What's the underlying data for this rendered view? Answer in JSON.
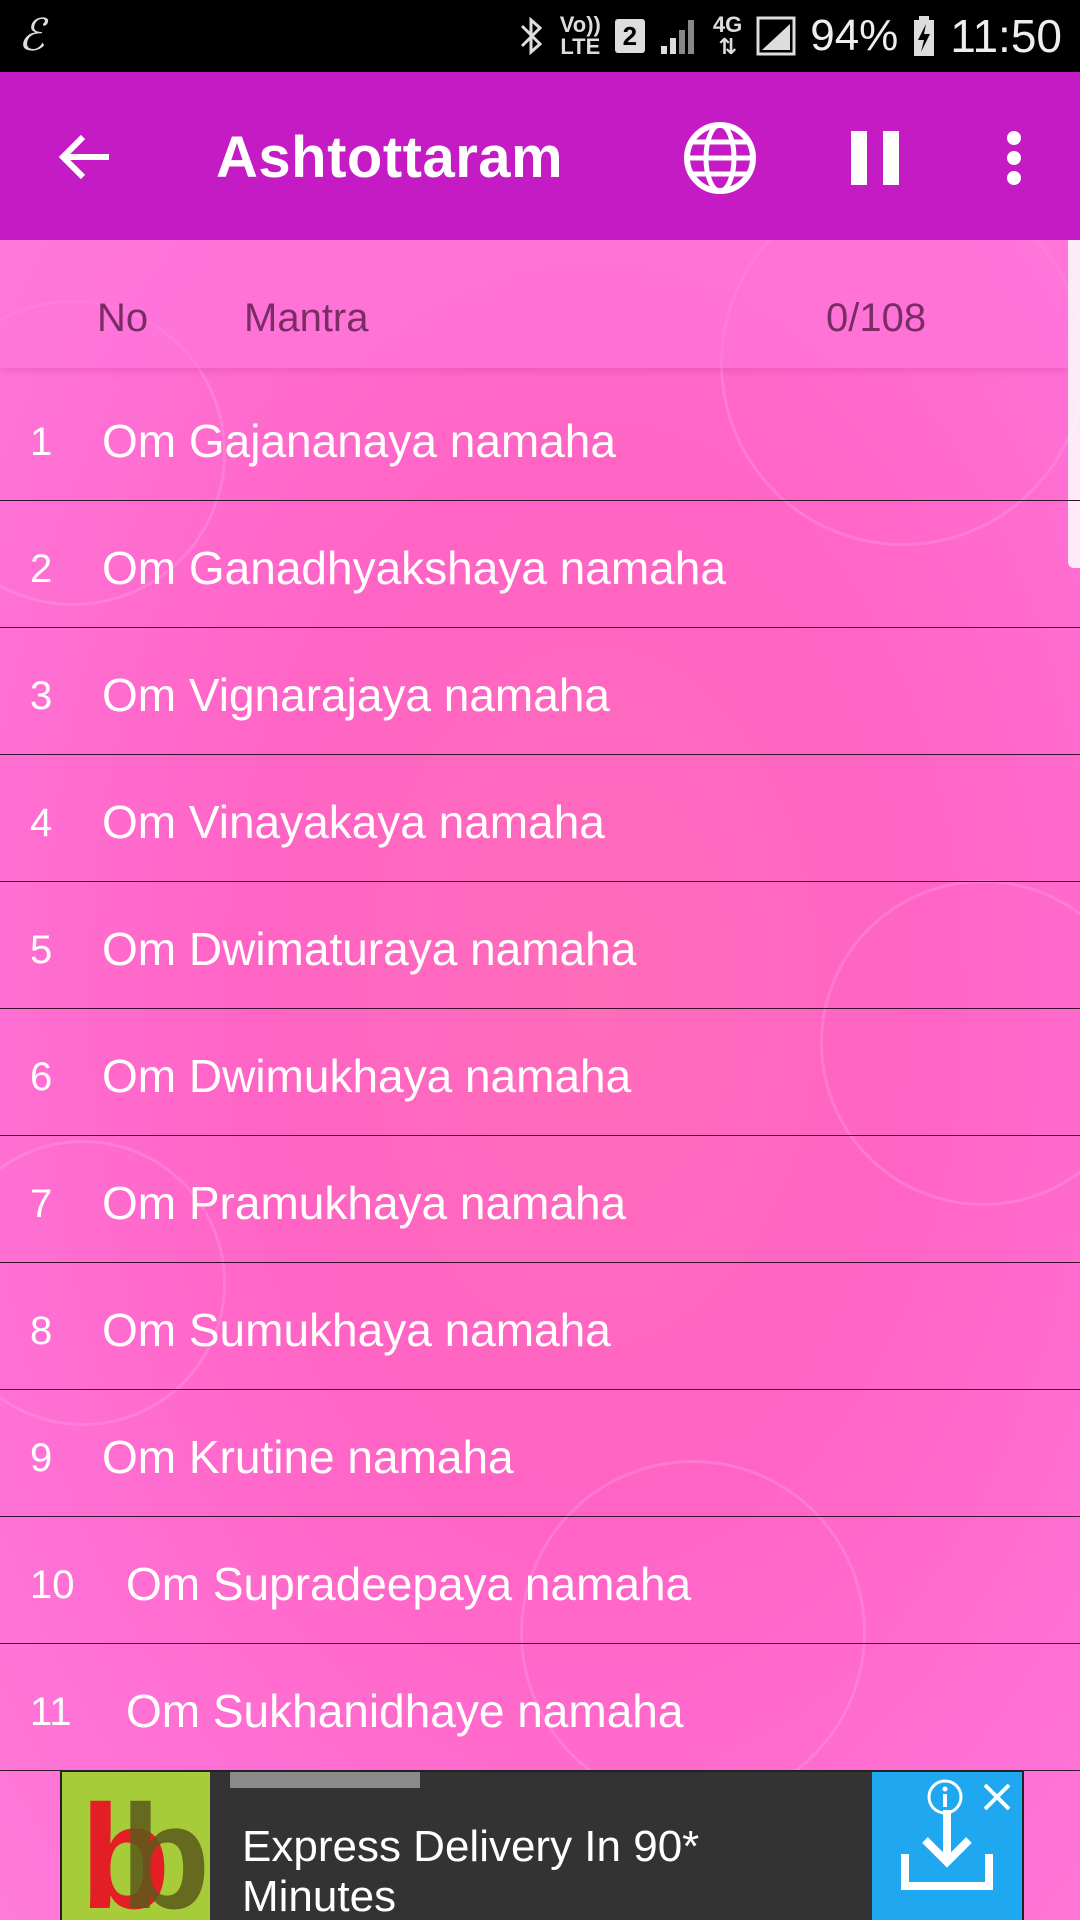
{
  "status_bar": {
    "left_icon": "notification-script-icon",
    "left_glyph": "ℰ",
    "volte_top": "Vo))",
    "volte_bottom": "LTE",
    "sim_slot": "2",
    "network_top": "4G",
    "network_bottom": "⇅",
    "battery_percent": "94%",
    "time": "11:50"
  },
  "app_bar": {
    "title": "Ashtottaram",
    "background": "#c41bc4",
    "back_icon": "arrow-left-icon",
    "language_icon": "globe-icon",
    "pause_icon": "pause-icon",
    "more_icon": "more-vert-icon"
  },
  "list_header": {
    "no_label": "No",
    "mantra_label": "Mantra",
    "count": "0/108"
  },
  "mantras": [
    {
      "no": "1",
      "text": "Om Gajananaya namaha"
    },
    {
      "no": "2",
      "text": "Om Ganadhyakshaya namaha"
    },
    {
      "no": "3",
      "text": "Om Vignarajaya namaha"
    },
    {
      "no": "4",
      "text": "Om Vinayakaya namaha"
    },
    {
      "no": "5",
      "text": "Om Dwimaturaya namaha"
    },
    {
      "no": "6",
      "text": "Om Dwimukhaya namaha"
    },
    {
      "no": "7",
      "text": "Om Pramukhaya namaha"
    },
    {
      "no": "8",
      "text": "Om Sumukhaya namaha"
    },
    {
      "no": "9",
      "text": "Om Krutine namaha"
    },
    {
      "no": "10",
      "text": "Om Supradeepaya namaha"
    },
    {
      "no": "11",
      "text": "Om Sukhanidhaye namaha"
    }
  ],
  "ad": {
    "logo_letter_1": "b",
    "logo_letter_2": "b",
    "text": "Express Delivery In 90* Minutes",
    "info_icon": "info-icon",
    "close_icon": "close-icon",
    "cta_icon": "download-icon",
    "cta_color": "#1fa8f0"
  }
}
